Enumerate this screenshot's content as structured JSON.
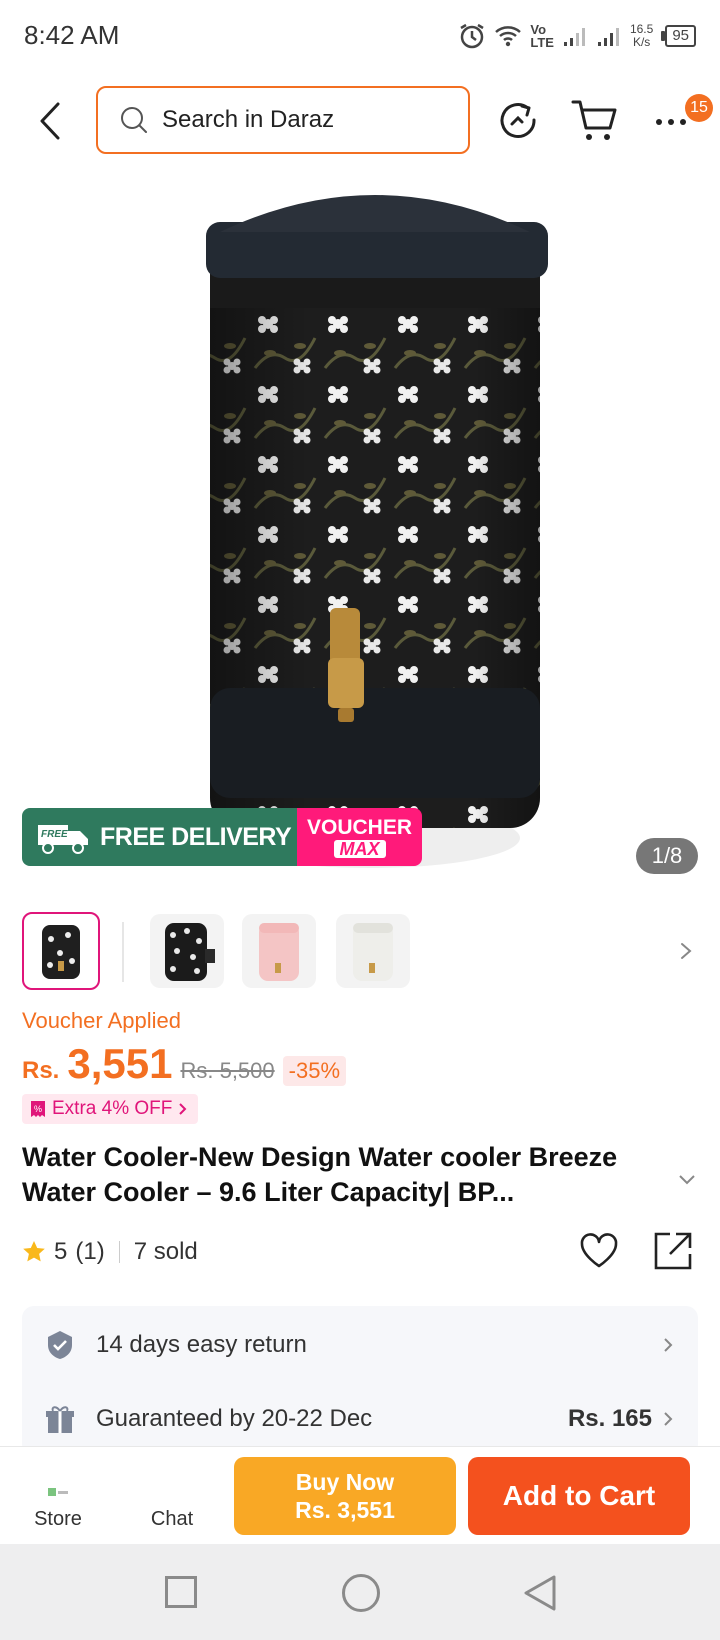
{
  "status_bar": {
    "time": "8:42 AM",
    "network_speed_value": "16.5",
    "network_speed_unit": "K/s",
    "battery": "95",
    "volte_top": "Vo",
    "volte_bottom": "LTE"
  },
  "header": {
    "search_placeholder": "Search in Daraz",
    "more_badge_count": "15"
  },
  "gallery": {
    "banner_free_small": "FREE",
    "banner_free_delivery": "FREE DELIVERY",
    "banner_voucher": "VOUCHER",
    "banner_max": "MAX",
    "counter": "1/8"
  },
  "price": {
    "voucher_applied": "Voucher Applied",
    "currency": "Rs.",
    "value": "3,551",
    "original": "Rs. 5,500",
    "discount": "-35%",
    "extra_off": "Extra 4% OFF"
  },
  "product": {
    "title": "Water Cooler-New Design Water cooler Breeze Water Cooler – 9.6 Liter Capacity| BP...",
    "rating": "5",
    "rating_count": "(1)",
    "sold": "7 sold"
  },
  "services": {
    "return_text": "14 days easy return",
    "guarantee_text": "Guaranteed by 20-22 Dec",
    "guarantee_price": "Rs. 165"
  },
  "bottom_bar": {
    "store_label": "Store",
    "chat_label": "Chat",
    "buy_now_label": "Buy Now",
    "buy_now_price": "Rs. 3,551",
    "add_to_cart_label": "Add to Cart"
  },
  "colors": {
    "accent": "#f36f21",
    "voucher_pink": "#ff1a7a",
    "delivery_green": "#2f7a5e",
    "buy_now": "#f9a825",
    "add_to_cart": "#f4511e"
  }
}
